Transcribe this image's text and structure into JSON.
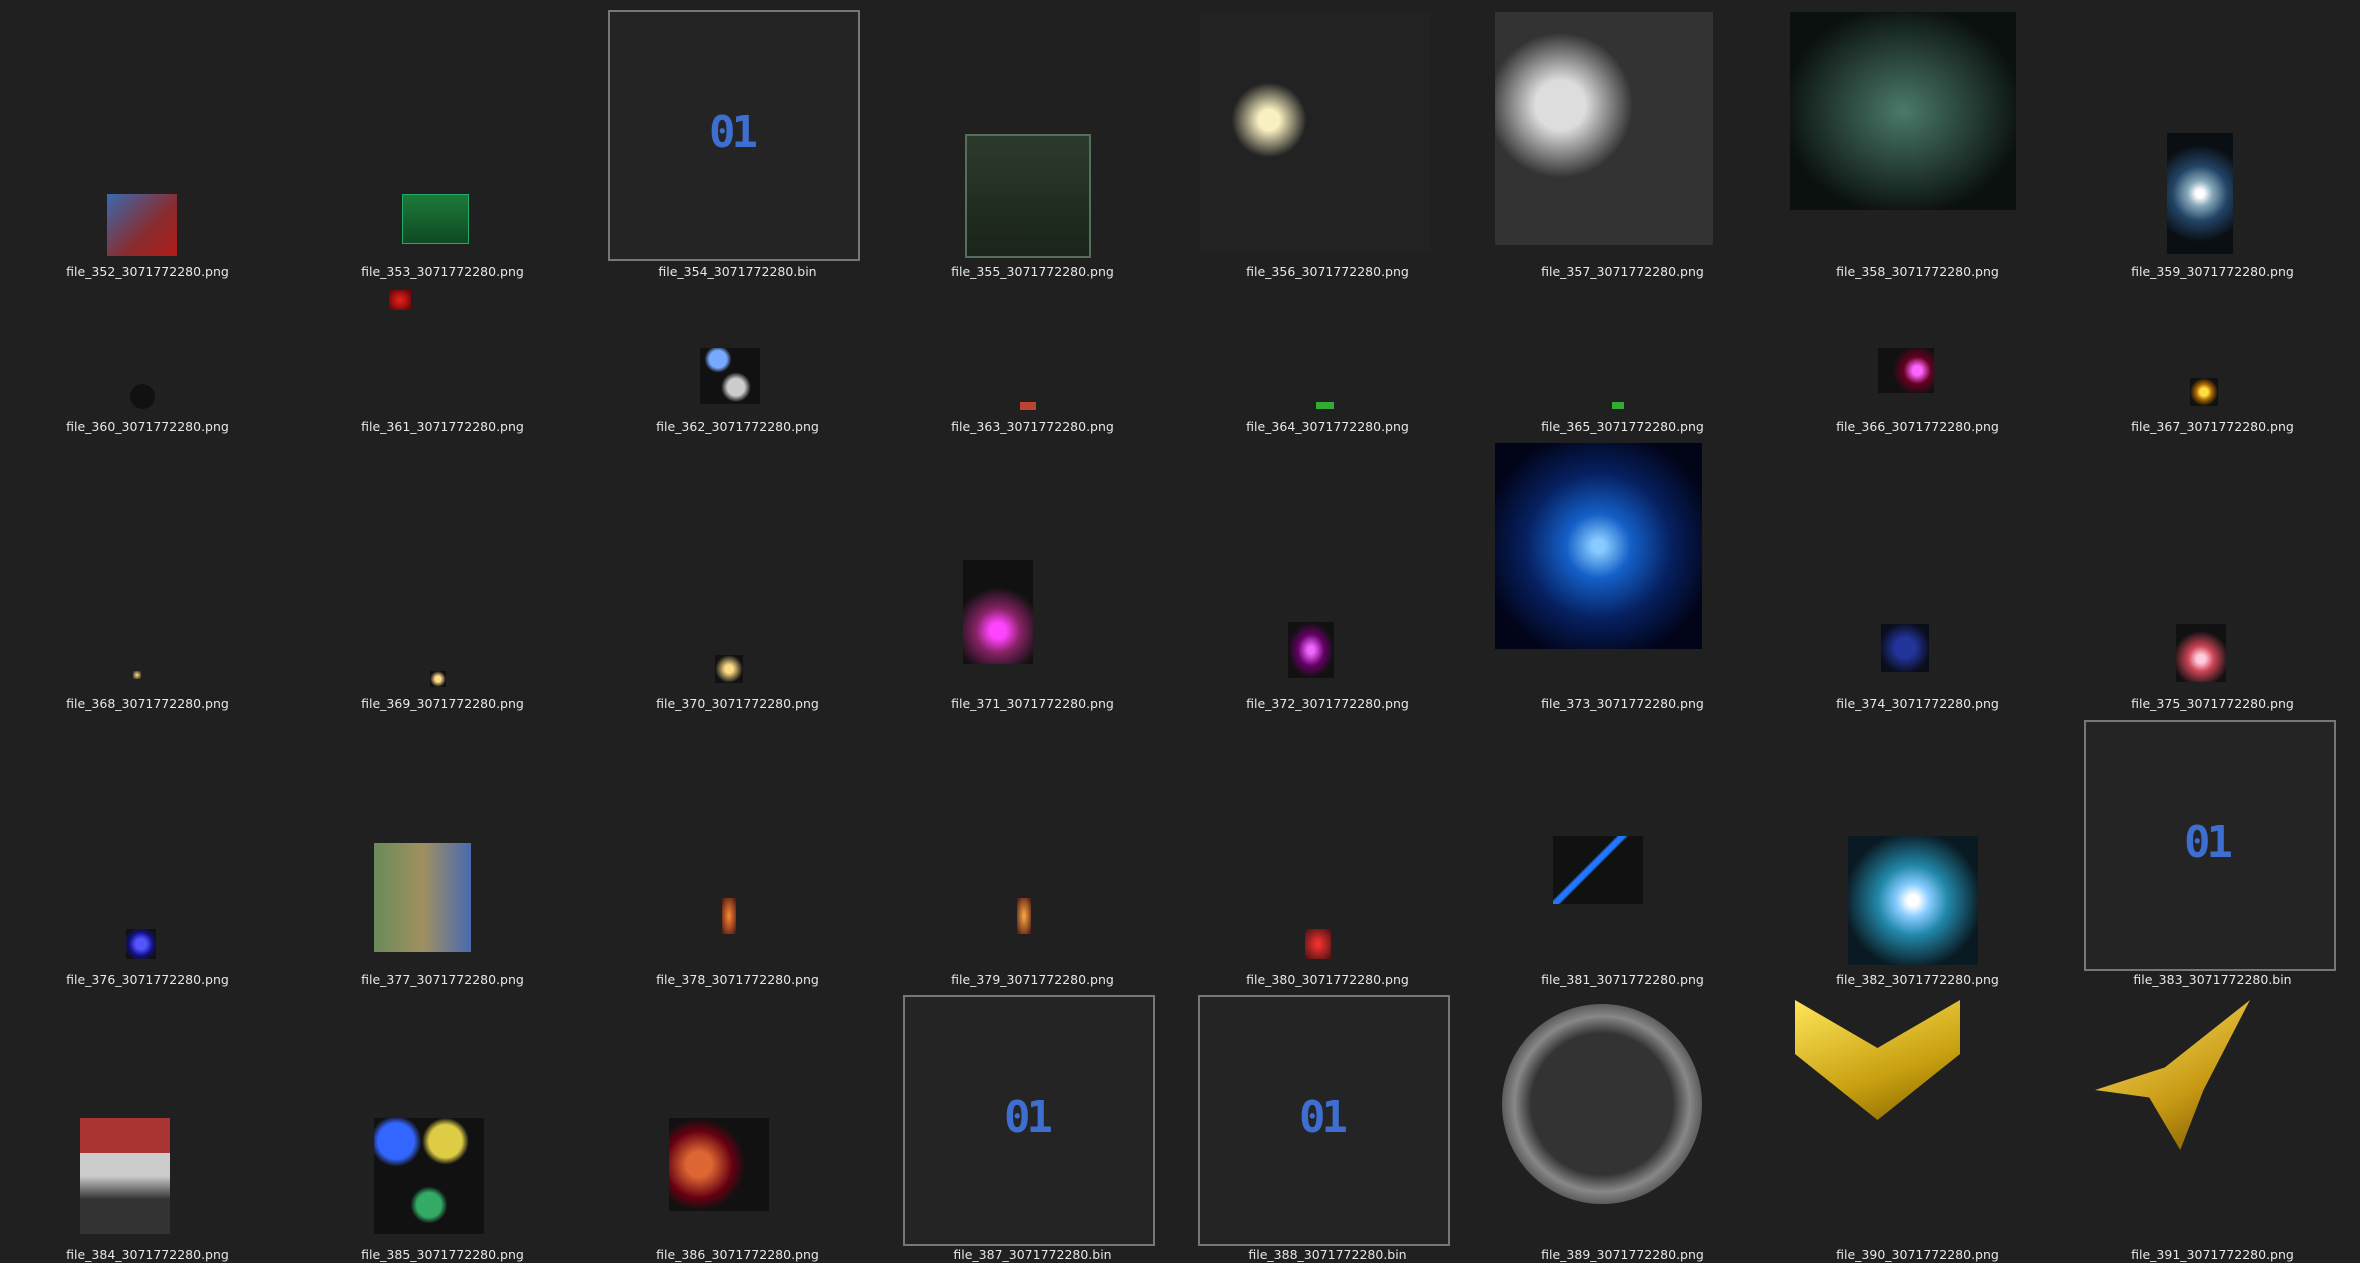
{
  "files": [
    {
      "name": "file_352_3071772280.png"
    },
    {
      "name": "file_353_3071772280.png"
    },
    {
      "name": "file_354_3071772280.bin",
      "icon": "binary-file-icon",
      "glyph": "01"
    },
    {
      "name": "file_355_3071772280.png"
    },
    {
      "name": "file_356_3071772280.png"
    },
    {
      "name": "file_357_3071772280.png"
    },
    {
      "name": "file_358_3071772280.png"
    },
    {
      "name": "file_359_3071772280.png"
    },
    {
      "name": "file_360_3071772280.png"
    },
    {
      "name": "file_361_3071772280.png"
    },
    {
      "name": "file_362_3071772280.png"
    },
    {
      "name": "file_363_3071772280.png"
    },
    {
      "name": "file_364_3071772280.png"
    },
    {
      "name": "file_365_3071772280.png"
    },
    {
      "name": "file_366_3071772280.png"
    },
    {
      "name": "file_367_3071772280.png"
    },
    {
      "name": "file_368_3071772280.png"
    },
    {
      "name": "file_369_3071772280.png"
    },
    {
      "name": "file_370_3071772280.png"
    },
    {
      "name": "file_371_3071772280.png"
    },
    {
      "name": "file_372_3071772280.png"
    },
    {
      "name": "file_373_3071772280.png"
    },
    {
      "name": "file_374_3071772280.png"
    },
    {
      "name": "file_375_3071772280.png"
    },
    {
      "name": "file_376_3071772280.png"
    },
    {
      "name": "file_377_3071772280.png"
    },
    {
      "name": "file_378_3071772280.png"
    },
    {
      "name": "file_379_3071772280.png"
    },
    {
      "name": "file_380_3071772280.png"
    },
    {
      "name": "file_381_3071772280.png"
    },
    {
      "name": "file_382_3071772280.png"
    },
    {
      "name": "file_383_3071772280.bin",
      "icon": "binary-file-icon",
      "glyph": "01"
    },
    {
      "name": "file_384_3071772280.png"
    },
    {
      "name": "file_385_3071772280.png"
    },
    {
      "name": "file_386_3071772280.png"
    },
    {
      "name": "file_387_3071772280.bin",
      "icon": "binary-file-icon",
      "glyph": "01"
    },
    {
      "name": "file_388_3071772280.bin",
      "icon": "binary-file-icon",
      "glyph": "01"
    },
    {
      "name": "file_389_3071772280.png"
    },
    {
      "name": "file_390_3071772280.png"
    },
    {
      "name": "file_391_3071772280.png"
    }
  ],
  "bin_glyph": "01",
  "colors": {
    "background": "#202020",
    "label": "#e8e8e8",
    "bin_icon": "#3e6fd0",
    "selection_border": "#7a7a7a"
  }
}
